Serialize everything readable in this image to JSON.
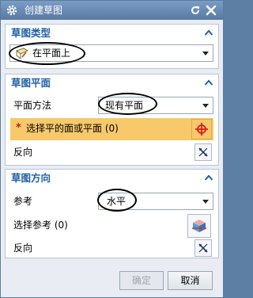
{
  "window": {
    "title": "创建草图",
    "icons": [
      "gear-icon",
      "reset-icon",
      "close-icon"
    ]
  },
  "sketch_type": {
    "header": "草图类型",
    "selected": "在平面上"
  },
  "sketch_plane": {
    "header": "草图平面",
    "plane_method_label": "平面方法",
    "plane_method_value": "现有平面",
    "select_prompt": "选择平的面或平面 (0)",
    "reverse_label": "反向"
  },
  "sketch_orientation": {
    "header": "草图方向",
    "reference_label": "参考",
    "reference_value": "水平",
    "select_reference_label": "选择参考 (0)",
    "reverse_label": "反向"
  },
  "footer": {
    "ok_label": "确定",
    "cancel_label": "取消"
  },
  "colors": {
    "title_bar": "#6a8cb6",
    "section_header": "#1f5fa8",
    "highlight_row": "#f7c96a",
    "required_star": "#c2181b",
    "crosshair": "#d81e1e"
  }
}
